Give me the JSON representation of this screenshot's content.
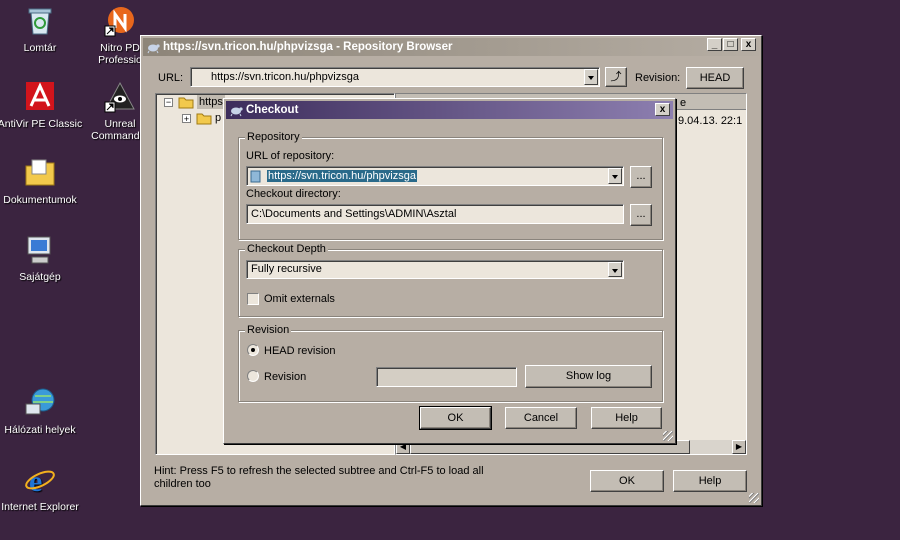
{
  "desktop": {
    "icons": [
      {
        "label": "Lomtár",
        "icon": "recycle-bin-icon"
      },
      {
        "label": "Nitro PD Professio",
        "icon": "nitro-pdf-icon"
      },
      {
        "label": "AntiVir PE Classic",
        "icon": "antivir-icon"
      },
      {
        "label": "Unreal Commander",
        "icon": "unreal-commander-icon"
      },
      {
        "label": "Dokumentumok",
        "icon": "documents-folder-icon"
      },
      {
        "label": "Sajátgép",
        "icon": "my-computer-icon"
      },
      {
        "label": "Hálózati helyek",
        "icon": "network-places-icon"
      },
      {
        "label": "Internet Explorer",
        "icon": "internet-explorer-icon"
      }
    ]
  },
  "repo_browser": {
    "title": "https://svn.tricon.hu/phpvizsga - Repository Browser",
    "url_label": "URL:",
    "url_value": "https://svn.tricon.hu/phpvizsga",
    "revision_label": "Revision:",
    "revision_button": "HEAD",
    "tree_root": "https",
    "tree_child": "p",
    "column_header": "e",
    "date_cell": "9.04.13. 22:1",
    "hint": "Hint: Press F5 to refresh the selected subtree and Ctrl-F5 to load all children too",
    "ok": "OK",
    "help": "Help",
    "win_minimize": "_",
    "win_maximize": "□",
    "win_close": "x"
  },
  "checkout": {
    "title": "Checkout",
    "close": "x",
    "repository_group": "Repository",
    "url_label": "URL of repository:",
    "url_value": "https://svn.tricon.hu/phpvizsga",
    "dir_label": "Checkout directory:",
    "dir_value": "C:\\Documents and Settings\\ADMIN\\Asztal",
    "browse": "...",
    "depth_group": "Checkout Depth",
    "depth_value": "Fully recursive",
    "omit_externals": "Omit externals",
    "revision_group": "Revision",
    "head_revision": "HEAD revision",
    "revision_option": "Revision",
    "show_log": "Show log",
    "ok": "OK",
    "cancel": "Cancel",
    "help": "Help"
  }
}
